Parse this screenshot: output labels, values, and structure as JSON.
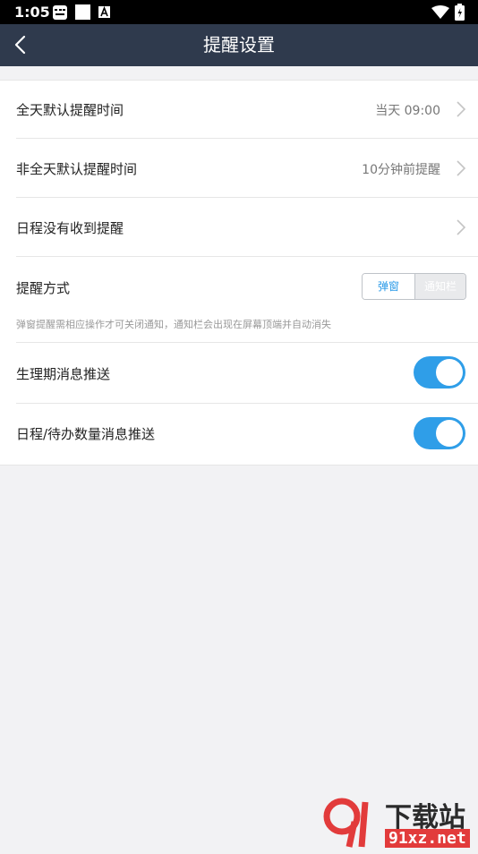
{
  "status_bar": {
    "time": "1:05"
  },
  "header": {
    "title": "提醒设置"
  },
  "settings": [
    {
      "label": "全天默认提醒时间",
      "value": "当天 09:00"
    },
    {
      "label": "非全天默认提醒时间",
      "value": "10分钟前提醒"
    },
    {
      "label": "日程没有收到提醒",
      "value": ""
    }
  ],
  "remind_mode": {
    "label": "提醒方式",
    "options": [
      "弹窗",
      "通知栏"
    ],
    "selected": "弹窗",
    "hint": "弹窗提醒需相应操作才可关闭通知，通知栏会出现在屏幕顶端并自动消失"
  },
  "toggles": [
    {
      "label": "生理期消息推送",
      "on": true
    },
    {
      "label": "日程/待办数量消息推送",
      "on": true
    }
  ],
  "colors": {
    "header": "#2f3a4d",
    "accent": "#2f9ee8"
  },
  "watermark": {
    "text": "下载站",
    "url_text": "91xz.net"
  }
}
